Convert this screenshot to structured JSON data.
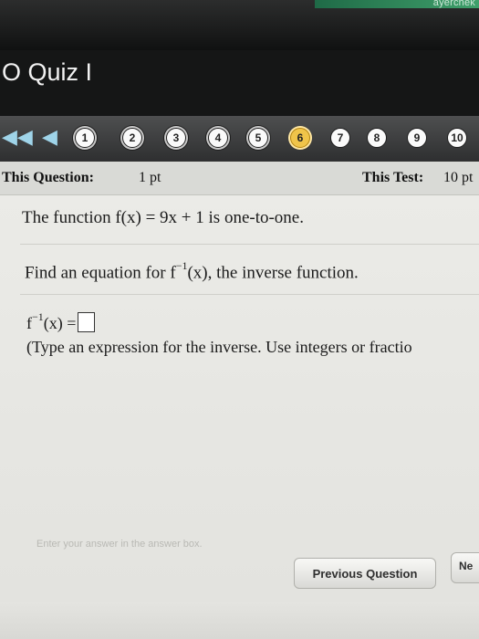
{
  "top_bar": {
    "corner_text": "ayerchek"
  },
  "header": {
    "quiz_title": "O Quiz I"
  },
  "nav": {
    "first_arrow": "◀◀",
    "prev_arrow": "◀",
    "questions": [
      "1",
      "2",
      "3",
      "4",
      "5",
      "6",
      "7",
      "8",
      "9",
      "10"
    ],
    "current_question": "6"
  },
  "info": {
    "this_question_label": "This Question:",
    "this_question_value": "1 pt",
    "this_test_label": "This Test:",
    "this_test_value": "10 pt"
  },
  "question": {
    "line1": "The function f(x) = 9x + 1 is one-to-one.",
    "line2_prefix": "Find an equation for f",
    "line2_sup": "−1",
    "line2_suffix": "(x),  the inverse function.",
    "answer_prefix": "f",
    "answer_sup": "−1",
    "answer_suffix": "(x) =",
    "instruction": "(Type an expression for the inverse. Use integers or fractio"
  },
  "footer": {
    "hint": "Enter your answer in the answer box.",
    "previous_label": "Previous Question",
    "next_label": "Ne"
  }
}
